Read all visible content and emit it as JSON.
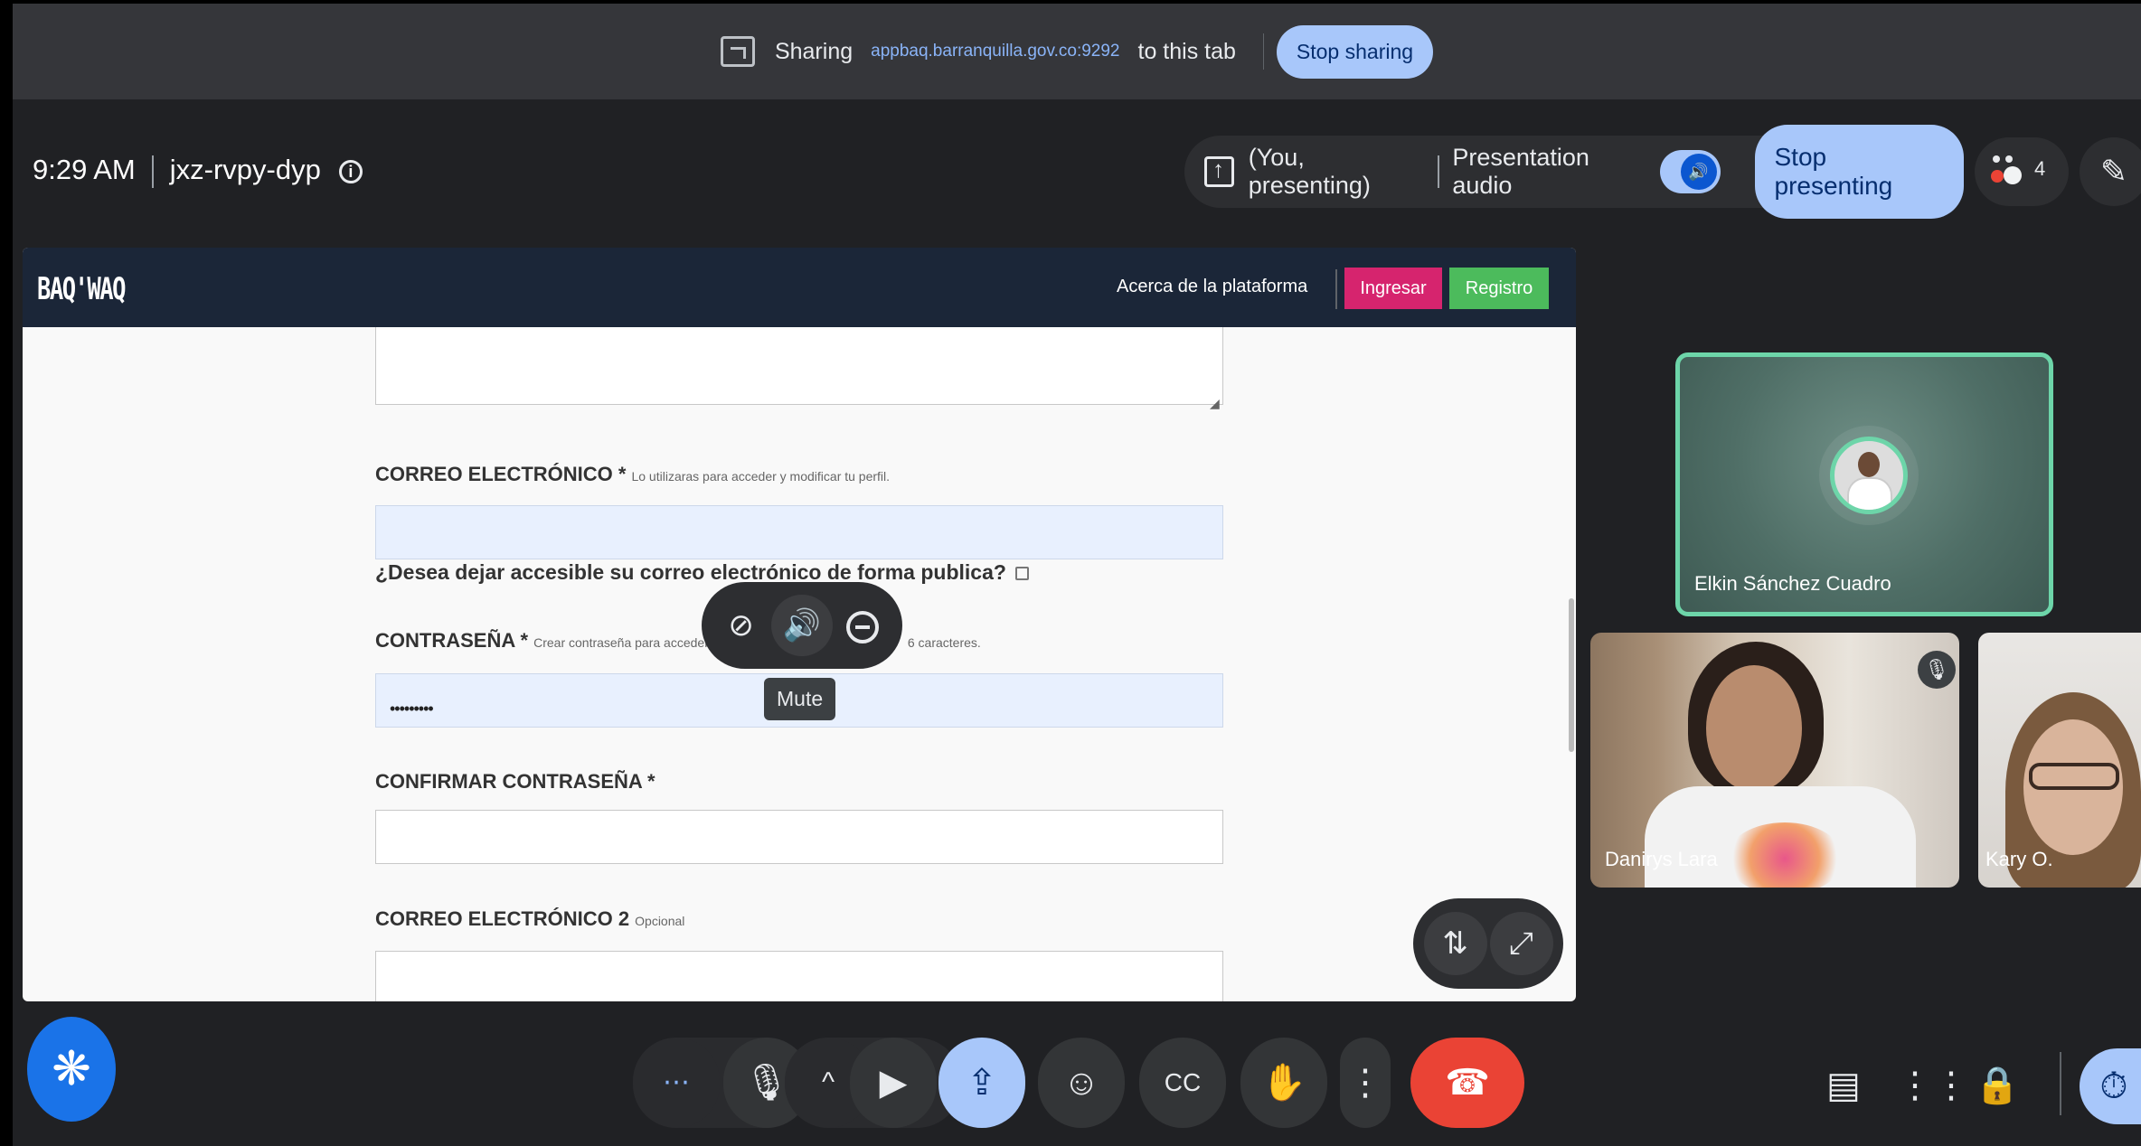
{
  "share_banner": {
    "label": "Sharing",
    "url": "appbaq.barranquilla.gov.co:9292",
    "suffix": "to this tab",
    "stop_button": "Stop sharing"
  },
  "meeting": {
    "time": "9:29 AM",
    "code": "jxz-rvpy-dyp",
    "presenting_label": "(You, presenting)",
    "presentation_audio_label": "Presentation audio",
    "stop_presenting": "Stop presenting",
    "participant_count": "4"
  },
  "shared_site": {
    "logo": "BAQ'WAQ",
    "nav_about": "Acerca de la plataforma",
    "nav_login": "Ingresar",
    "nav_register": "Registro",
    "email_label": "CORREO ELECTRÓNICO *",
    "email_hint": "Lo utilizaras para acceder y modificar tu perfil.",
    "public_question": "¿Desea dejar accesible su correo electrónico de forma publica?",
    "password_label": "CONTRASEÑA *",
    "password_hint": "Crear contraseña para acceder",
    "password_hint_tail": "6 caracteres.",
    "password_value": "•••••••••",
    "confirm_label": "CONFIRMAR CONTRASEÑA *",
    "email2_label": "CORREO ELECTRÓNICO 2",
    "email2_hint": "Opcional",
    "colors": {
      "nav_bg": "#1b2638",
      "login_bg": "#d6246e",
      "register_bg": "#4cbb5c"
    }
  },
  "hover_controls": {
    "tooltip": "Mute",
    "icons": [
      "unpin-icon",
      "volume-icon",
      "remove-icon"
    ]
  },
  "participants": [
    {
      "name": "Elkin Sánchez Cuadro",
      "speaking": true
    },
    {
      "name": "Danirys Lara",
      "muted": true
    },
    {
      "name": "Kary O."
    }
  ],
  "controls": {
    "icons": [
      "more-icon",
      "mic-icon",
      "chevron-up-icon",
      "camera-icon",
      "present-icon",
      "emoji-icon",
      "captions-icon",
      "raise-hand-icon",
      "more-vert-icon",
      "hangup-icon"
    ],
    "right_icons": [
      "chat-icon",
      "apps-icon",
      "host-controls-icon",
      "timer-icon"
    ],
    "colors": {
      "accent": "#a8c7fa",
      "hangup": "#ea4335",
      "fab": "#1a73e8"
    }
  }
}
